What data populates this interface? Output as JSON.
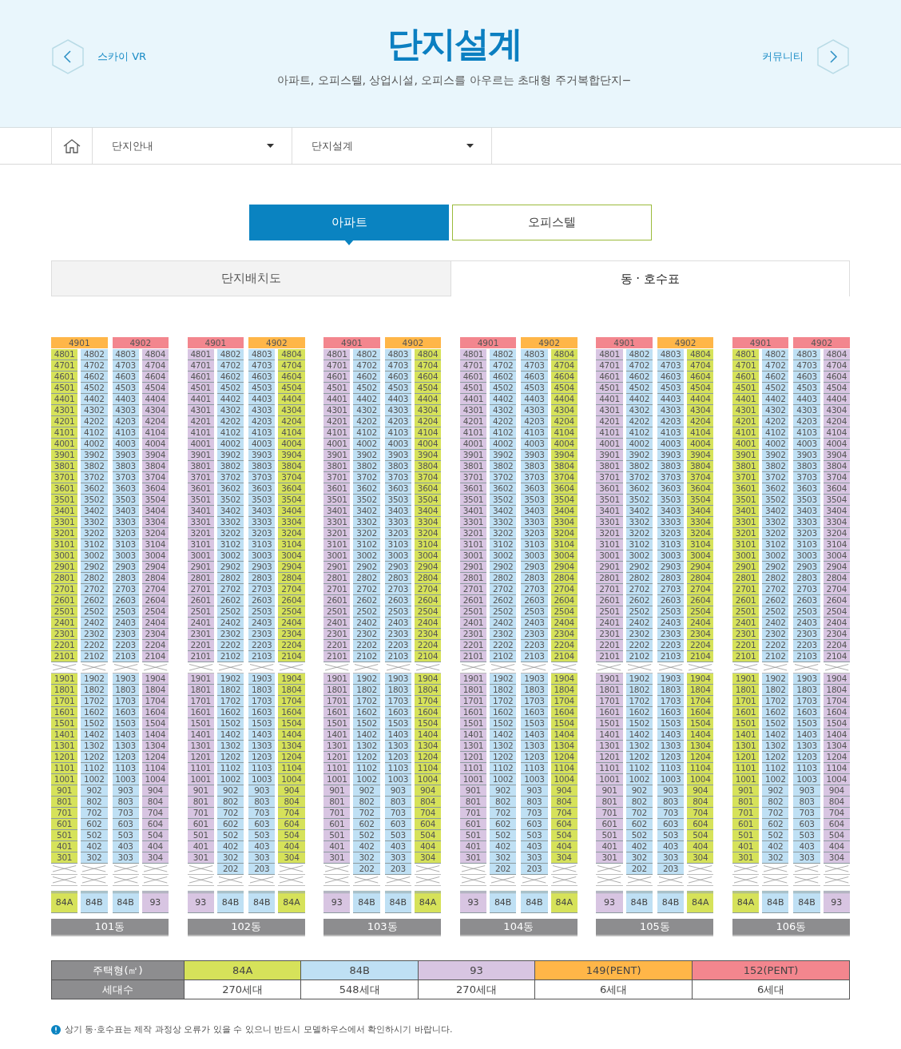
{
  "header": {
    "title": "단지설계",
    "subtitle": "아파트, 오피스텔, 상업시설, 오피스를 아우르는 초대형 주거복합단지−",
    "prev": "스카이 VR",
    "next": "커뮤니티"
  },
  "breadcrumb": [
    "단지안내",
    "단지설계"
  ],
  "tabs": [
    {
      "label": "아파트",
      "selected": true
    },
    {
      "label": "오피스텔",
      "selected": false
    }
  ],
  "sub_tabs": [
    {
      "label": "단지배치도",
      "selected": false
    },
    {
      "label": "동 · 호수표",
      "selected": true
    }
  ],
  "buildings": [
    {
      "name": "101동",
      "penthouses": [
        {
          "label": "4901",
          "color": "#ffb648"
        },
        {
          "label": "4902",
          "color": "#f3868e"
        }
      ],
      "columns": [
        {
          "type": "84A",
          "color": "#d6e25a",
          "upper": [
            "4801",
            "4701",
            "4601",
            "4501",
            "4401",
            "4301",
            "4201",
            "4101",
            "4001",
            "3901",
            "3801",
            "3701",
            "3601",
            "3501",
            "3401",
            "3301",
            "3201",
            "3101",
            "3001",
            "2901",
            "2801",
            "2701",
            "2601",
            "2501",
            "2401",
            "2301",
            "2201",
            "2101"
          ],
          "lower": [
            "1901",
            "1801",
            "1701",
            "1601",
            "1501",
            "1401",
            "1301",
            "1201",
            "1101",
            "1001",
            "901",
            "801",
            "701",
            "601",
            "501",
            "401",
            "301"
          ]
        },
        {
          "type": "84B",
          "color": "#bfe0f4",
          "upper": [
            "4802",
            "4702",
            "4602",
            "4502",
            "4402",
            "4302",
            "4202",
            "4102",
            "4002",
            "3902",
            "3802",
            "3702",
            "3602",
            "3502",
            "3402",
            "3302",
            "3202",
            "3102",
            "3002",
            "2902",
            "2802",
            "2702",
            "2602",
            "2502",
            "2402",
            "2302",
            "2202",
            "2102"
          ],
          "lower": [
            "1902",
            "1802",
            "1702",
            "1602",
            "1502",
            "1402",
            "1302",
            "1202",
            "1102",
            "1002",
            "902",
            "802",
            "702",
            "602",
            "502",
            "402",
            "302"
          ]
        },
        {
          "type": "84B",
          "color": "#bfe0f4",
          "upper": [
            "4803",
            "4703",
            "4603",
            "4503",
            "4403",
            "4303",
            "4203",
            "4103",
            "4003",
            "3903",
            "3803",
            "3703",
            "3603",
            "3503",
            "3403",
            "3303",
            "3203",
            "3103",
            "3003",
            "2903",
            "2803",
            "2703",
            "2603",
            "2503",
            "2403",
            "2303",
            "2203",
            "2103"
          ],
          "lower": [
            "1903",
            "1803",
            "1703",
            "1603",
            "1503",
            "1403",
            "1303",
            "1203",
            "1103",
            "1003",
            "903",
            "803",
            "703",
            "603",
            "503",
            "403",
            "303"
          ]
        },
        {
          "type": "93",
          "color": "#d8c5e2",
          "upper": [
            "4804",
            "4704",
            "4604",
            "4504",
            "4404",
            "4304",
            "4204",
            "4104",
            "4004",
            "3904",
            "3804",
            "3704",
            "3604",
            "3504",
            "3404",
            "3304",
            "3204",
            "3104",
            "3004",
            "2904",
            "2804",
            "2704",
            "2604",
            "2504",
            "2404",
            "2304",
            "2204",
            "2104"
          ],
          "lower": [
            "1904",
            "1804",
            "1704",
            "1604",
            "1504",
            "1404",
            "1304",
            "1204",
            "1104",
            "1004",
            "904",
            "804",
            "704",
            "604",
            "504",
            "404",
            "304"
          ]
        }
      ]
    },
    {
      "name": "102동",
      "penthouses": [
        {
          "label": "4901",
          "color": "#f3868e"
        },
        {
          "label": "4902",
          "color": "#ffb648"
        }
      ],
      "columns": [
        {
          "type": "93",
          "color": "#d8c5e2",
          "upper": [
            "4801",
            "4701",
            "4601",
            "4501",
            "4401",
            "4301",
            "4201",
            "4101",
            "4001",
            "3901",
            "3801",
            "3701",
            "3601",
            "3501",
            "3401",
            "3301",
            "3201",
            "3101",
            "3001",
            "2901",
            "2801",
            "2701",
            "2601",
            "2501",
            "2401",
            "2301",
            "2201",
            "2101"
          ],
          "lower": [
            "1901",
            "1801",
            "1701",
            "1601",
            "1501",
            "1401",
            "1301",
            "1201",
            "1101",
            "1001",
            "901",
            "801",
            "701",
            "601",
            "501",
            "401",
            "301"
          ]
        },
        {
          "type": "84B",
          "color": "#bfe0f4",
          "upper": [
            "4802",
            "4702",
            "4602",
            "4502",
            "4402",
            "4302",
            "4202",
            "4102",
            "4002",
            "3902",
            "3802",
            "3702",
            "3602",
            "3502",
            "3402",
            "3302",
            "3202",
            "3102",
            "3002",
            "2902",
            "2802",
            "2702",
            "2602",
            "2502",
            "2402",
            "2302",
            "2202",
            "2102"
          ],
          "lower": [
            "1902",
            "1802",
            "1702",
            "1602",
            "1502",
            "1402",
            "1302",
            "1202",
            "1102",
            "1002",
            "902",
            "802",
            "702",
            "602",
            "502",
            "402",
            "302",
            "202"
          ]
        },
        {
          "type": "84B",
          "color": "#bfe0f4",
          "upper": [
            "4803",
            "4703",
            "4603",
            "4503",
            "4403",
            "4303",
            "4203",
            "4103",
            "4003",
            "3903",
            "3803",
            "3703",
            "3603",
            "3503",
            "3403",
            "3303",
            "3203",
            "3103",
            "3003",
            "2903",
            "2803",
            "2703",
            "2603",
            "2503",
            "2403",
            "2303",
            "2203",
            "2103"
          ],
          "lower": [
            "1903",
            "1803",
            "1703",
            "1603",
            "1503",
            "1403",
            "1303",
            "1203",
            "1103",
            "1003",
            "903",
            "803",
            "703",
            "603",
            "503",
            "403",
            "303",
            "203"
          ]
        },
        {
          "type": "84A",
          "color": "#d6e25a",
          "upper": [
            "4804",
            "4704",
            "4604",
            "4504",
            "4404",
            "4304",
            "4204",
            "4104",
            "4004",
            "3904",
            "3804",
            "3704",
            "3604",
            "3504",
            "3404",
            "3304",
            "3204",
            "3104",
            "3004",
            "2904",
            "2804",
            "2704",
            "2604",
            "2504",
            "2404",
            "2304",
            "2204",
            "2104"
          ],
          "lower": [
            "1904",
            "1804",
            "1704",
            "1604",
            "1504",
            "1404",
            "1304",
            "1204",
            "1104",
            "1004",
            "904",
            "804",
            "704",
            "604",
            "504",
            "404",
            "304"
          ]
        }
      ]
    },
    {
      "name": "103동",
      "penthouses": [
        {
          "label": "4901",
          "color": "#f3868e"
        },
        {
          "label": "4902",
          "color": "#ffb648"
        }
      ],
      "columns": [
        {
          "type": "93",
          "color": "#d8c5e2",
          "upper": [
            "4801",
            "4701",
            "4601",
            "4501",
            "4401",
            "4301",
            "4201",
            "4101",
            "4001",
            "3901",
            "3801",
            "3701",
            "3601",
            "3501",
            "3401",
            "3301",
            "3201",
            "3101",
            "3001",
            "2901",
            "2801",
            "2701",
            "2601",
            "2501",
            "2401",
            "2301",
            "2201",
            "2101"
          ],
          "lower": [
            "1901",
            "1801",
            "1701",
            "1601",
            "1501",
            "1401",
            "1301",
            "1201",
            "1101",
            "1001",
            "901",
            "801",
            "701",
            "601",
            "501",
            "401",
            "301"
          ]
        },
        {
          "type": "84B",
          "color": "#bfe0f4",
          "upper": [
            "4802",
            "4702",
            "4602",
            "4502",
            "4402",
            "4302",
            "4202",
            "4102",
            "4002",
            "3902",
            "3802",
            "3702",
            "3602",
            "3502",
            "3402",
            "3302",
            "3202",
            "3102",
            "3002",
            "2902",
            "2802",
            "2702",
            "2602",
            "2502",
            "2402",
            "2302",
            "2202",
            "2102"
          ],
          "lower": [
            "1902",
            "1802",
            "1702",
            "1602",
            "1502",
            "1402",
            "1302",
            "1202",
            "1102",
            "1002",
            "902",
            "802",
            "702",
            "602",
            "502",
            "402",
            "302",
            "202"
          ]
        },
        {
          "type": "84B",
          "color": "#bfe0f4",
          "upper": [
            "4803",
            "4703",
            "4603",
            "4503",
            "4403",
            "4303",
            "4203",
            "4103",
            "4003",
            "3903",
            "3803",
            "3703",
            "3603",
            "3503",
            "3403",
            "3303",
            "3203",
            "3103",
            "3003",
            "2903",
            "2803",
            "2703",
            "2603",
            "2503",
            "2403",
            "2303",
            "2203",
            "2103"
          ],
          "lower": [
            "1903",
            "1803",
            "1703",
            "1603",
            "1503",
            "1403",
            "1303",
            "1203",
            "1103",
            "1003",
            "903",
            "803",
            "703",
            "603",
            "503",
            "403",
            "303",
            "203"
          ]
        },
        {
          "type": "84A",
          "color": "#d6e25a",
          "upper": [
            "4804",
            "4704",
            "4604",
            "4504",
            "4404",
            "4304",
            "4204",
            "4104",
            "4004",
            "3904",
            "3804",
            "3704",
            "3604",
            "3504",
            "3404",
            "3304",
            "3204",
            "3104",
            "3004",
            "2904",
            "2804",
            "2704",
            "2604",
            "2504",
            "2404",
            "2304",
            "2204",
            "2104"
          ],
          "lower": [
            "1904",
            "1804",
            "1704",
            "1604",
            "1504",
            "1404",
            "1304",
            "1204",
            "1104",
            "1004",
            "904",
            "804",
            "704",
            "604",
            "504",
            "404",
            "304"
          ]
        }
      ]
    },
    {
      "name": "104동",
      "penthouses": [
        {
          "label": "4901",
          "color": "#f3868e"
        },
        {
          "label": "4902",
          "color": "#ffb648"
        }
      ],
      "columns": [
        {
          "type": "93",
          "color": "#d8c5e2",
          "upper": [
            "4801",
            "4701",
            "4601",
            "4501",
            "4401",
            "4301",
            "4201",
            "4101",
            "4001",
            "3901",
            "3801",
            "3701",
            "3601",
            "3501",
            "3401",
            "3301",
            "3201",
            "3101",
            "3001",
            "2901",
            "2801",
            "2701",
            "2601",
            "2501",
            "2401",
            "2301",
            "2201",
            "2101"
          ],
          "lower": [
            "1901",
            "1801",
            "1701",
            "1601",
            "1501",
            "1401",
            "1301",
            "1201",
            "1101",
            "1001",
            "901",
            "801",
            "701",
            "601",
            "501",
            "401",
            "301"
          ]
        },
        {
          "type": "84B",
          "color": "#bfe0f4",
          "upper": [
            "4802",
            "4702",
            "4602",
            "4502",
            "4402",
            "4302",
            "4202",
            "4102",
            "4002",
            "3902",
            "3802",
            "3702",
            "3602",
            "3502",
            "3402",
            "3302",
            "3202",
            "3102",
            "3002",
            "2902",
            "2802",
            "2702",
            "2602",
            "2502",
            "2402",
            "2302",
            "2202",
            "2102"
          ],
          "lower": [
            "1902",
            "1802",
            "1702",
            "1602",
            "1502",
            "1402",
            "1302",
            "1202",
            "1102",
            "1002",
            "902",
            "802",
            "702",
            "602",
            "502",
            "402",
            "302",
            "202"
          ]
        },
        {
          "type": "84B",
          "color": "#bfe0f4",
          "upper": [
            "4803",
            "4703",
            "4603",
            "4503",
            "4403",
            "4303",
            "4203",
            "4103",
            "4003",
            "3903",
            "3803",
            "3703",
            "3603",
            "3503",
            "3403",
            "3303",
            "3203",
            "3103",
            "3003",
            "2903",
            "2803",
            "2703",
            "2603",
            "2503",
            "2403",
            "2303",
            "2203",
            "2103"
          ],
          "lower": [
            "1903",
            "1803",
            "1703",
            "1603",
            "1503",
            "1403",
            "1303",
            "1203",
            "1103",
            "1003",
            "903",
            "803",
            "703",
            "603",
            "503",
            "403",
            "303",
            "203"
          ]
        },
        {
          "type": "84A",
          "color": "#d6e25a",
          "upper": [
            "4804",
            "4704",
            "4604",
            "4504",
            "4404",
            "4304",
            "4204",
            "4104",
            "4004",
            "3904",
            "3804",
            "3704",
            "3604",
            "3504",
            "3404",
            "3304",
            "3204",
            "3104",
            "3004",
            "2904",
            "2804",
            "2704",
            "2604",
            "2504",
            "2404",
            "2304",
            "2204",
            "2104"
          ],
          "lower": [
            "1904",
            "1804",
            "1704",
            "1604",
            "1504",
            "1404",
            "1304",
            "1204",
            "1104",
            "1004",
            "904",
            "804",
            "704",
            "604",
            "504",
            "404",
            "304"
          ]
        }
      ]
    },
    {
      "name": "105동",
      "penthouses": [
        {
          "label": "4901",
          "color": "#f3868e"
        },
        {
          "label": "4902",
          "color": "#ffb648"
        }
      ],
      "columns": [
        {
          "type": "93",
          "color": "#d8c5e2",
          "upper": [
            "4801",
            "4701",
            "4601",
            "4501",
            "4401",
            "4301",
            "4201",
            "4101",
            "4001",
            "3901",
            "3801",
            "3701",
            "3601",
            "3501",
            "3401",
            "3301",
            "3201",
            "3101",
            "3001",
            "2901",
            "2801",
            "2701",
            "2601",
            "2501",
            "2401",
            "2301",
            "2201",
            "2101"
          ],
          "lower": [
            "1901",
            "1801",
            "1701",
            "1601",
            "1501",
            "1401",
            "1301",
            "1201",
            "1101",
            "1001",
            "901",
            "801",
            "701",
            "601",
            "501",
            "401",
            "301"
          ]
        },
        {
          "type": "84B",
          "color": "#bfe0f4",
          "upper": [
            "4802",
            "4702",
            "4602",
            "4502",
            "4402",
            "4302",
            "4202",
            "4102",
            "4002",
            "3902",
            "3802",
            "3702",
            "3602",
            "3502",
            "3402",
            "3302",
            "3202",
            "3102",
            "3002",
            "2902",
            "2802",
            "2702",
            "2602",
            "2502",
            "2402",
            "2302",
            "2202",
            "2102"
          ],
          "lower": [
            "1902",
            "1802",
            "1702",
            "1602",
            "1502",
            "1402",
            "1302",
            "1202",
            "1102",
            "1002",
            "902",
            "802",
            "702",
            "602",
            "502",
            "402",
            "302",
            "202"
          ]
        },
        {
          "type": "84B",
          "color": "#bfe0f4",
          "upper": [
            "4803",
            "4703",
            "4603",
            "4503",
            "4403",
            "4303",
            "4203",
            "4103",
            "4003",
            "3903",
            "3803",
            "3703",
            "3603",
            "3503",
            "3403",
            "3303",
            "3203",
            "3103",
            "3003",
            "2903",
            "2803",
            "2703",
            "2603",
            "2503",
            "2403",
            "2303",
            "2203",
            "2103"
          ],
          "lower": [
            "1903",
            "1803",
            "1703",
            "1603",
            "1503",
            "1403",
            "1303",
            "1203",
            "1103",
            "1003",
            "903",
            "803",
            "703",
            "603",
            "503",
            "403",
            "303",
            "203"
          ]
        },
        {
          "type": "84A",
          "color": "#d6e25a",
          "upper": [
            "4804",
            "4704",
            "4604",
            "4504",
            "4404",
            "4304",
            "4204",
            "4104",
            "4004",
            "3904",
            "3804",
            "3704",
            "3604",
            "3504",
            "3404",
            "3304",
            "3204",
            "3104",
            "3004",
            "2904",
            "2804",
            "2704",
            "2604",
            "2504",
            "2404",
            "2304",
            "2204",
            "2104"
          ],
          "lower": [
            "1904",
            "1804",
            "1704",
            "1604",
            "1504",
            "1404",
            "1304",
            "1204",
            "1104",
            "1004",
            "904",
            "804",
            "704",
            "604",
            "504",
            "404",
            "304"
          ]
        }
      ]
    },
    {
      "name": "106동",
      "penthouses": [
        {
          "label": "4901",
          "color": "#f3868e"
        },
        {
          "label": "4902",
          "color": "#f3868e"
        }
      ],
      "columns": [
        {
          "type": "84A",
          "color": "#d6e25a",
          "upper": [
            "4801",
            "4701",
            "4601",
            "4501",
            "4401",
            "4301",
            "4201",
            "4101",
            "4001",
            "3901",
            "3801",
            "3701",
            "3601",
            "3501",
            "3401",
            "3301",
            "3201",
            "3101",
            "3001",
            "2901",
            "2801",
            "2701",
            "2601",
            "2501",
            "2401",
            "2301",
            "2201",
            "2101"
          ],
          "lower": [
            "1901",
            "1801",
            "1701",
            "1601",
            "1501",
            "1401",
            "1301",
            "1201",
            "1101",
            "1001",
            "901",
            "801",
            "701",
            "601",
            "501",
            "401",
            "301"
          ]
        },
        {
          "type": "84B",
          "color": "#bfe0f4",
          "upper": [
            "4802",
            "4702",
            "4602",
            "4502",
            "4402",
            "4302",
            "4202",
            "4102",
            "4002",
            "3902",
            "3802",
            "3702",
            "3602",
            "3502",
            "3402",
            "3302",
            "3202",
            "3102",
            "3002",
            "2902",
            "2802",
            "2702",
            "2602",
            "2502",
            "2402",
            "2302",
            "2202",
            "2102"
          ],
          "lower": [
            "1902",
            "1802",
            "1702",
            "1602",
            "1502",
            "1402",
            "1302",
            "1202",
            "1102",
            "1002",
            "902",
            "802",
            "702",
            "602",
            "502",
            "402",
            "302"
          ]
        },
        {
          "type": "84B",
          "color": "#bfe0f4",
          "upper": [
            "4803",
            "4703",
            "4603",
            "4503",
            "4403",
            "4303",
            "4203",
            "4103",
            "4003",
            "3903",
            "3803",
            "3703",
            "3603",
            "3503",
            "3403",
            "3303",
            "3203",
            "3103",
            "3003",
            "2903",
            "2803",
            "2703",
            "2603",
            "2503",
            "2403",
            "2303",
            "2203",
            "2103"
          ],
          "lower": [
            "1903",
            "1803",
            "1703",
            "1603",
            "1503",
            "1403",
            "1303",
            "1203",
            "1103",
            "1003",
            "903",
            "803",
            "703",
            "603",
            "503",
            "403",
            "303"
          ]
        },
        {
          "type": "93",
          "color": "#d8c5e2",
          "upper": [
            "4804",
            "4704",
            "4604",
            "4504",
            "4404",
            "4304",
            "4204",
            "4104",
            "4004",
            "3904",
            "3804",
            "3704",
            "3604",
            "3504",
            "3404",
            "3304",
            "3204",
            "3104",
            "3004",
            "2904",
            "2804",
            "2704",
            "2604",
            "2504",
            "2404",
            "2304",
            "2204",
            "2104"
          ],
          "lower": [
            "1904",
            "1804",
            "1704",
            "1604",
            "1504",
            "1404",
            "1304",
            "1204",
            "1104",
            "1004",
            "904",
            "804",
            "704",
            "604",
            "504",
            "404",
            "304"
          ]
        }
      ]
    }
  ],
  "legend": {
    "type_heading": "주택형(㎡)",
    "count_heading": "세대수",
    "types": [
      {
        "label": "84A",
        "color": "#d6e25a",
        "count": "270세대"
      },
      {
        "label": "84B",
        "color": "#bfe0f4",
        "count": "548세대"
      },
      {
        "label": "93",
        "color": "#d8c5e2",
        "count": "270세대"
      },
      {
        "label": "149(PENT)",
        "color": "#ffb648",
        "count": "6세대"
      },
      {
        "label": "152(PENT)",
        "color": "#f3868e",
        "count": "6세대"
      }
    ]
  },
  "notice": "상기 동·호수표는 제작 과정상 오류가 있을 수 있으니 반드시 모델하우스에서 확인하시기 바랍니다."
}
